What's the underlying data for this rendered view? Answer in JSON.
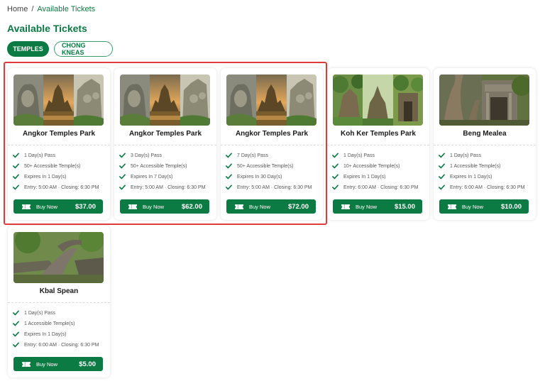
{
  "breadcrumb": {
    "home": "Home",
    "separator": "/",
    "current": "Available Tickets"
  },
  "page_title": "Available Tickets",
  "tabs": [
    {
      "label": "TEMPLES",
      "active": true
    },
    {
      "label": "CHONG KNEAS",
      "active": false
    }
  ],
  "colors": {
    "accent": "#0b7a43",
    "highlight": "#e03a3a"
  },
  "buy_label": "Buy Now",
  "cards": [
    {
      "title": "Angkor Temples Park",
      "features": [
        "1 Day(s) Pass",
        "50+ Accessible Temple(s)",
        "Expires In 1 Day(s)",
        "Entry: 5:00 AM · Closing: 6:30 PM"
      ],
      "price": "$37.00"
    },
    {
      "title": "Angkor Temples Park",
      "features": [
        "3 Day(s) Pass",
        "50+ Accessible Temple(s)",
        "Expires In 7 Day(s)",
        "Entry: 5:00 AM · Closing: 6:30 PM"
      ],
      "price": "$62.00"
    },
    {
      "title": "Angkor Temples Park",
      "features": [
        "7 Day(s) Pass",
        "50+ Accessible Temple(s)",
        "Expires In 30 Day(s)",
        "Entry: 5:00 AM · Closing: 6:30 PM"
      ],
      "price": "$72.00"
    },
    {
      "title": "Koh Ker Temples Park",
      "features": [
        "1 Day(s) Pass",
        "10+ Accessible Temple(s)",
        "Expires In 1 Day(s)",
        "Entry: 6:00 AM · Closing: 6:30 PM"
      ],
      "price": "$15.00"
    },
    {
      "title": "Beng Mealea",
      "features": [
        "1 Day(s) Pass",
        "1 Accessible Temple(s)",
        "Expires In 1 Day(s)",
        "Entry: 6:00 AM · Closing: 6:30 PM"
      ],
      "price": "$10.00"
    },
    {
      "title": "Kbal Spean",
      "features": [
        "1 Day(s) Pass",
        "1 Accessible Temple(s)",
        "Expires In 1 Day(s)",
        "Entry: 6:00 AM · Closing: 6:30 PM"
      ],
      "price": "$5.00"
    }
  ]
}
